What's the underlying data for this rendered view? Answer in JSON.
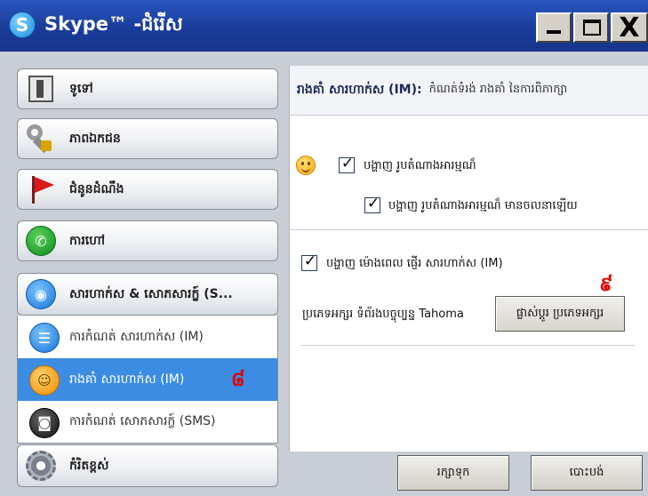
{
  "window": {
    "title": "Skype™ -ជំរើស",
    "logo_letter": "S",
    "controls": {
      "minimize": "_",
      "maximize": "□",
      "close": "X"
    }
  },
  "sidebar": {
    "items": [
      {
        "id": "general",
        "label": "ទូទៅ",
        "icon": "door-icon"
      },
      {
        "id": "privacy",
        "label": "ភាពឯកជន",
        "icon": "keys-icon"
      },
      {
        "id": "notifications",
        "label": "ជំនូនដំណឹង",
        "icon": "flag-icon"
      },
      {
        "id": "calls",
        "label": "ការហៅ",
        "icon": "phone-icon"
      },
      {
        "id": "im_sms",
        "label": "សារហាក់ស & សោភសារក្ខ៍ (S...",
        "icon": "chat-icon"
      },
      {
        "id": "advanced",
        "label": "កំរិតខ្ពស់",
        "icon": "gear-icon"
      }
    ],
    "sub_items": [
      {
        "id": "im_settings",
        "label": "ការកំណត់ សារហាក់ស (IM)",
        "icon": "chat-bubble-icon"
      },
      {
        "id": "im_appearance",
        "label": "រាងគាំ សារហាក់ស (IM)",
        "icon": "smiley-icon",
        "selected": true
      },
      {
        "id": "sms_settings",
        "label": "ការកំណត់ សោភសារក្ខ៍ (SMS)",
        "icon": "sms-icon"
      }
    ],
    "marker": "៨"
  },
  "content": {
    "header_title": "រាងគាំ សារហាក់ស (IM):",
    "header_subtitle": "កំណត់ទំរង់ រាងគាំ នៃការពិភាក្សា",
    "options": {
      "show_emoticons": {
        "label": "បង្ហាញ រូបតំណាងអារម្មណ៏",
        "checked": true
      },
      "show_animated_emoticons": {
        "label": "បង្ហាញ រូបតំណាងអារម្មណ៏ មានចលនាឡើយ",
        "checked": true
      },
      "show_timestamps": {
        "label": "បង្ហាញ ម៉ោងពេល ផ្ញើរ សារហាក់ស (IM)",
        "checked": true
      }
    },
    "font_label": "ប្រភេទអក្សរ ទំព័រ​ងបច្ចុប្បន្ន Tahoma",
    "change_font_button": "ផ្លាស់ប្តូរ ប្រភេទអក្សរ",
    "marker": "៩"
  },
  "footer": {
    "save_button": "រក្សាទុក",
    "cancel_button": "បោះបង់"
  }
}
